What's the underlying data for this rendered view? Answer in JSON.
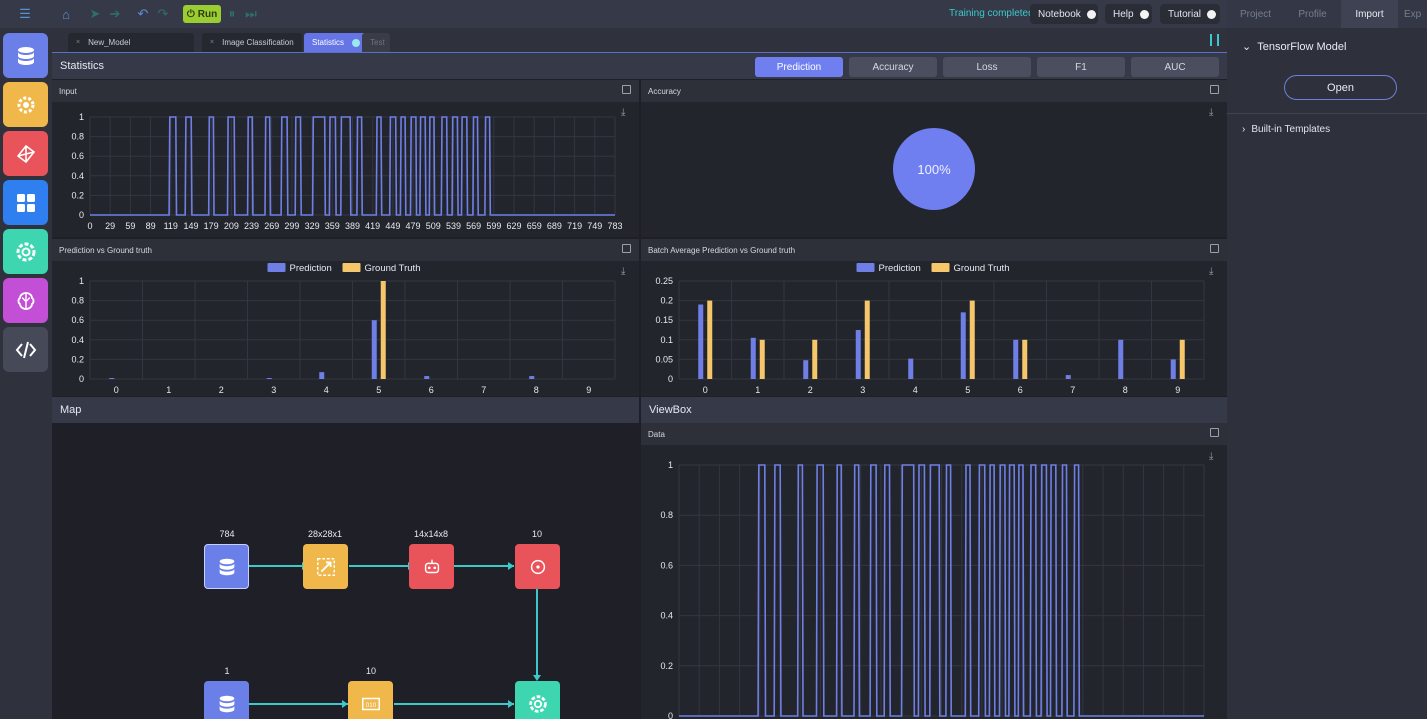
{
  "topbar": {
    "run_label": "Run",
    "status": "Training completed",
    "notebook": "Notebook",
    "help": "Help",
    "tutorial": "Tutorial"
  },
  "right_panel": {
    "tabs": [
      "Project",
      "Profile",
      "Import",
      "Exp"
    ],
    "active_tab": "Import",
    "tf_model": "TensorFlow Model",
    "open": "Open",
    "builtin": "Built-in Templates"
  },
  "tabs": [
    {
      "label": "New_Model"
    },
    {
      "label": "Image Classification"
    },
    {
      "label": "Statistics"
    },
    {
      "label": "Test"
    }
  ],
  "statistics": {
    "title": "Statistics",
    "buttons": [
      "Prediction",
      "Accuracy",
      "Loss",
      "F1",
      "AUC"
    ],
    "active": "Prediction"
  },
  "panels": {
    "input": "Input",
    "accuracy": "Accuracy",
    "pred_gt": "Prediction vs Ground truth",
    "batch_avg": "Batch Average Prediction vs Ground truth",
    "data": "Data"
  },
  "sections": {
    "map": "Map",
    "viewbox": "ViewBox"
  },
  "accuracy_value": "100%",
  "colors": {
    "accent": "#6f7ff0",
    "prediction": "#6f7fe6",
    "ground_truth": "#f6c66a",
    "status": "#3bc9c9",
    "run": "#9acd32"
  },
  "map_nodes": [
    {
      "label": "784",
      "icon": "database-icon"
    },
    {
      "label": "28x28x1",
      "icon": "reshape-icon"
    },
    {
      "label": "14x14x8",
      "icon": "conv-icon"
    },
    {
      "label": "10",
      "icon": "softmax-icon"
    },
    {
      "label": "1",
      "icon": "database-icon"
    },
    {
      "label": "10",
      "icon": "onehot-icon"
    },
    {
      "label": "",
      "icon": "training-icon"
    }
  ],
  "chart_data": [
    {
      "type": "line",
      "title": "Input",
      "ylim": [
        0,
        1
      ],
      "yticks": [
        "1",
        "0.8",
        "0.6",
        "0.4",
        "0.2",
        "0"
      ],
      "xticks": [
        "0",
        "29",
        "59",
        "89",
        "119",
        "149",
        "179",
        "209",
        "239",
        "269",
        "299",
        "329",
        "359",
        "389",
        "419",
        "449",
        "479",
        "509",
        "539",
        "569",
        "599",
        "629",
        "659",
        "689",
        "719",
        "749",
        "783"
      ],
      "xlim": [
        0,
        783
      ],
      "pulses": [
        [
          119,
          128
        ],
        [
          143,
          151
        ],
        [
          178,
          184
        ],
        [
          206,
          215
        ],
        [
          236,
          242
        ],
        [
          262,
          268
        ],
        [
          286,
          294
        ],
        [
          307,
          314
        ],
        [
          333,
          350
        ],
        [
          358,
          366
        ],
        [
          375,
          388
        ],
        [
          399,
          405
        ],
        [
          428,
          434
        ],
        [
          448,
          456
        ],
        [
          464,
          470
        ],
        [
          479,
          486
        ],
        [
          493,
          500
        ],
        [
          507,
          513
        ],
        [
          525,
          532
        ],
        [
          541,
          548
        ],
        [
          555,
          562
        ],
        [
          572,
          578
        ],
        [
          590,
          596
        ]
      ],
      "grid": true
    },
    {
      "type": "bar",
      "title": "Prediction vs Ground truth",
      "categories": [
        "0",
        "1",
        "2",
        "3",
        "4",
        "5",
        "6",
        "7",
        "8",
        "9"
      ],
      "series": [
        {
          "name": "Prediction",
          "values": [
            0.01,
            0,
            0,
            0.01,
            0.07,
            0.6,
            0.03,
            0,
            0.03,
            0
          ]
        },
        {
          "name": "Ground Truth",
          "values": [
            0,
            0,
            0,
            0,
            0,
            1,
            0,
            0,
            0,
            0
          ]
        }
      ],
      "ylim": [
        0,
        1
      ],
      "yticks": [
        "1",
        "0.8",
        "0.6",
        "0.4",
        "0.2",
        "0"
      ],
      "grid": true,
      "legend": "top-center"
    },
    {
      "type": "bar",
      "title": "Batch Average Prediction vs Ground truth",
      "categories": [
        "0",
        "1",
        "2",
        "3",
        "4",
        "5",
        "6",
        "7",
        "8",
        "9"
      ],
      "series": [
        {
          "name": "Prediction",
          "values": [
            0.19,
            0.105,
            0.048,
            0.125,
            0.052,
            0.17,
            0.1,
            0.01,
            0.1,
            0.05
          ]
        },
        {
          "name": "Ground Truth",
          "values": [
            0.2,
            0.1,
            0.1,
            0.2,
            0,
            0.2,
            0.1,
            0,
            0,
            0.1
          ]
        }
      ],
      "ylim": [
        0,
        0.25
      ],
      "yticks": [
        "0.25",
        "0.2",
        "0.15",
        "0.1",
        "0.05",
        "0"
      ],
      "grid": true,
      "legend": "top-center"
    },
    {
      "type": "line",
      "title": "Data",
      "ylim": [
        0,
        1
      ],
      "yticks": [
        "1",
        "0.8",
        "0.6",
        "0.4",
        "0.2",
        "0"
      ],
      "xlim": [
        0,
        783
      ],
      "pulses": [
        [
          119,
          128
        ],
        [
          143,
          151
        ],
        [
          178,
          184
        ],
        [
          206,
          215
        ],
        [
          236,
          242
        ],
        [
          262,
          268
        ],
        [
          286,
          294
        ],
        [
          307,
          314
        ],
        [
          333,
          350
        ],
        [
          358,
          366
        ],
        [
          375,
          388
        ],
        [
          399,
          405
        ],
        [
          428,
          434
        ],
        [
          448,
          456
        ],
        [
          464,
          470
        ],
        [
          479,
          486
        ],
        [
          493,
          500
        ],
        [
          507,
          513
        ],
        [
          525,
          532
        ],
        [
          541,
          548
        ],
        [
          555,
          562
        ],
        [
          572,
          578
        ],
        [
          590,
          596
        ]
      ],
      "grid": true
    }
  ]
}
